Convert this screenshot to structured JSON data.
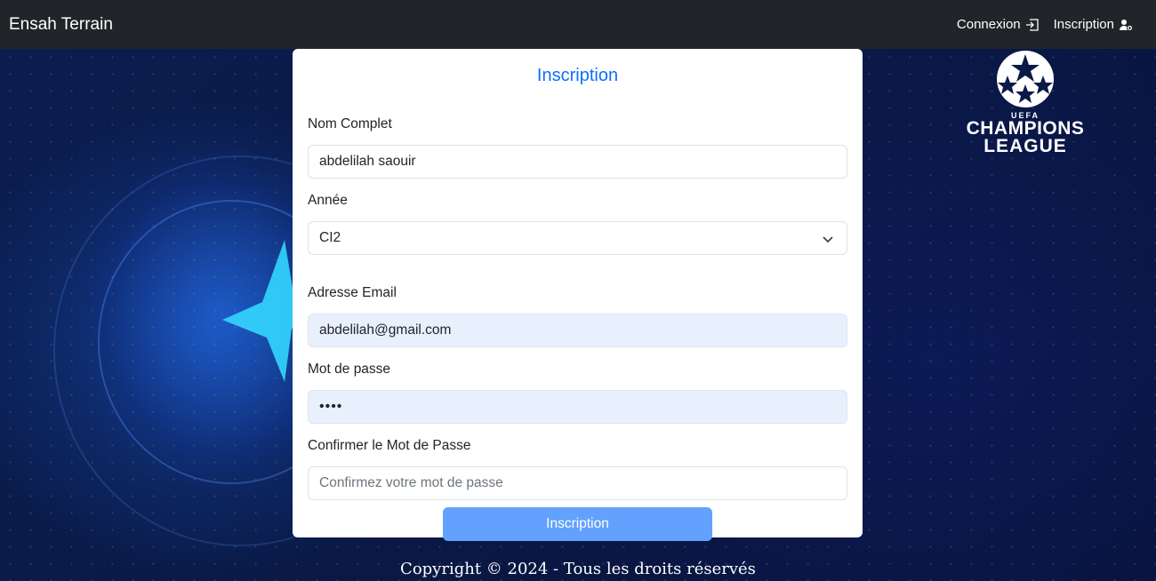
{
  "navbar": {
    "brand": "Ensah Terrain",
    "links": [
      {
        "label": "Connexion",
        "icon": "login-icon"
      },
      {
        "label": "Inscription",
        "icon": "user-plus-icon"
      }
    ]
  },
  "logo": {
    "line1": "UEFA",
    "line2": "CHAMPIONS",
    "line3": "LEAGUE"
  },
  "form": {
    "title": "Inscription",
    "fields": [
      {
        "label": "Nom Complet",
        "value": "abdelilah saouir"
      },
      {
        "label": "Année",
        "value": "CI2"
      },
      {
        "label": "Adresse Email",
        "value": "abdelilah@gmail.com"
      },
      {
        "label": "Mot de passe",
        "value": "••••"
      },
      {
        "label": "Confirmer le Mot de Passe",
        "placeholder": "Confirmez votre mot de passe"
      }
    ],
    "submit_label": "Inscription"
  },
  "footer": {
    "text": "Copyright © 2024 - Tous les droits réservés"
  },
  "colors": {
    "navbar_bg": "#212529",
    "accent": "#0d6efd",
    "button_bg": "#62a1fe",
    "autofill_bg": "#e8f0fe"
  }
}
